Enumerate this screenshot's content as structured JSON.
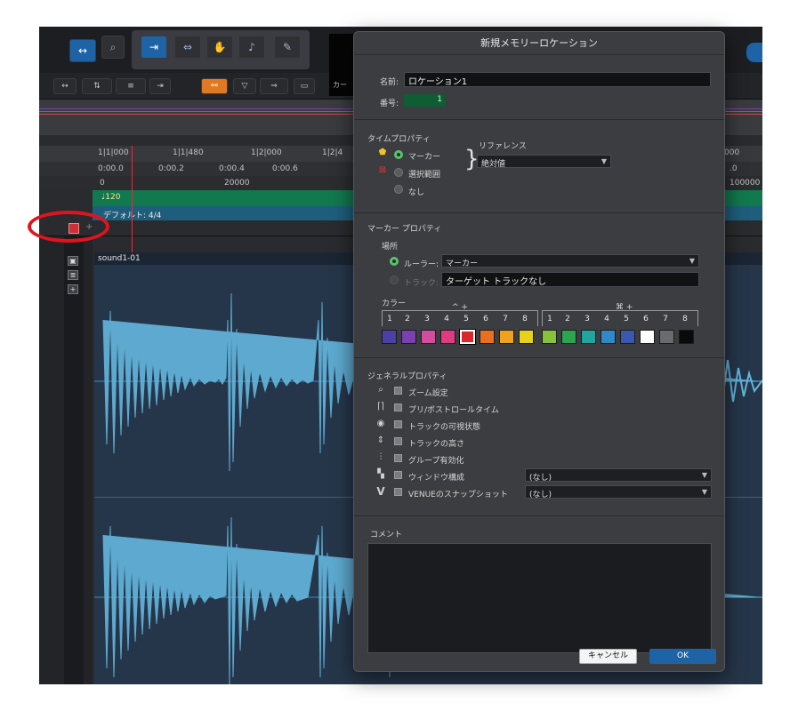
{
  "dialog": {
    "title": "新規メモリーロケーション",
    "name_label": "名前:",
    "name_value": "ロケーション1",
    "number_label": "番号:",
    "number_value": "1",
    "time_props": {
      "heading": "タイムプロパティ",
      "options": [
        "マーカー",
        "選択範囲",
        "なし"
      ],
      "selected": "マーカー",
      "reference_label": "リファレンス",
      "reference_value": "絶対値"
    },
    "marker_props": {
      "heading": "マーカー プロパティ",
      "location_label": "場所",
      "ruler_label": "ルーラー:",
      "ruler_value": "マーカー",
      "track_label": "トラック:",
      "track_value": "ターゲット トラックなし",
      "color_label": "カラー",
      "group1_mod": "^ +",
      "group2_mod": "⌘ +",
      "color_numbers": [
        "1",
        "2",
        "3",
        "4",
        "5",
        "6",
        "7",
        "8"
      ],
      "colors": [
        "#4b3fa8",
        "#7a3fb0",
        "#d24da0",
        "#e03a80",
        "#d8282a",
        "#ea6f1f",
        "#f0a21c",
        "#e6d21a",
        "#86c23a",
        "#2aa64f",
        "#1fa5a0",
        "#2f88c7",
        "#3b58b0",
        "#ffffff",
        "#6b6b6e",
        "#0a0a0a"
      ],
      "selected_index": 4
    },
    "general_props": {
      "heading": "ジェネラルプロパティ",
      "items": [
        "ズーム設定",
        "プリ/ポストロールタイム",
        "トラックの可視状態",
        "トラックの高さ",
        "グループ有効化",
        "ウィンドウ構成",
        "VENUEのスナップショット"
      ],
      "window_dropdown": "(なし)",
      "venue_dropdown": "(なし)"
    },
    "comment_label": "コメント",
    "cancel_label": "キャンセル",
    "ok_label": "OK"
  },
  "daw": {
    "counter_label": "カー",
    "ruler_bars": [
      "1|1|000",
      "1|1|480",
      "1|2|000",
      "1|2|4"
    ],
    "ruler_time": [
      "0:00.0",
      "0:00.2",
      "0:00.4",
      "0:00.6"
    ],
    "ruler_samples": [
      "0",
      "20000"
    ],
    "tempo_value": "♩120",
    "meter_label": "デフォルト: 4/4",
    "clip_name": "sound1-01",
    "right_ruler": [
      "000",
      ".0",
      "100000"
    ]
  }
}
